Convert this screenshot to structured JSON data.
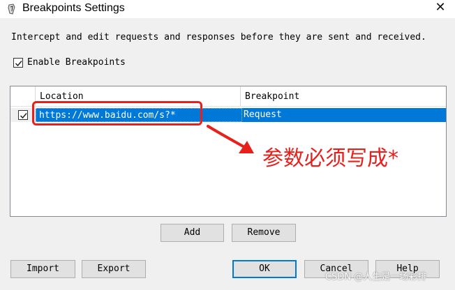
{
  "window": {
    "title": "Breakpoints Settings",
    "close_glyph": "✕",
    "icon": "fiddler-app-icon"
  },
  "description": "Intercept and edit requests and responses before they are sent and received.",
  "enable_breakpoints": {
    "label": "Enable Breakpoints",
    "checked": true
  },
  "table": {
    "columns": [
      "Location",
      "Breakpoint"
    ],
    "rows": [
      {
        "checked": true,
        "location": "https://www.baidu.com/s?*",
        "breakpoint": "Request",
        "selected": true
      }
    ]
  },
  "annotation": {
    "text": "参数必须写成*",
    "color": "#e8201c"
  },
  "buttons": {
    "add": "Add",
    "remove": "Remove",
    "import": "Import",
    "export": "Export",
    "ok": "OK",
    "cancel": "Cancel",
    "help": "Help"
  },
  "watermark": "CSDN @人生是一场彩排",
  "colors": {
    "selection": "#0078d7",
    "dialog_bg": "#f0f0f0",
    "annotation": "#e8201c"
  }
}
